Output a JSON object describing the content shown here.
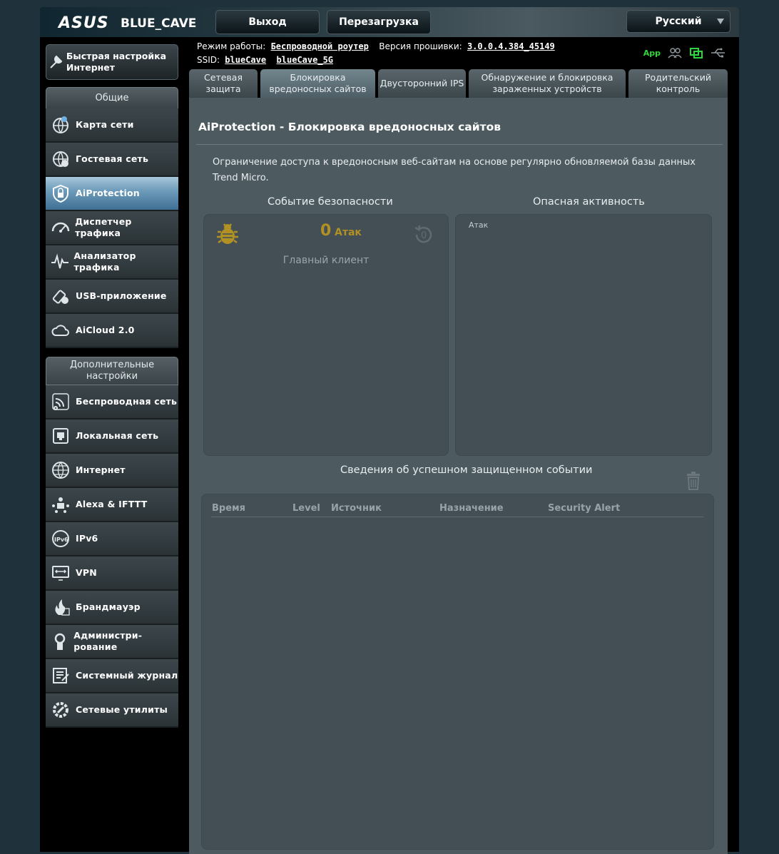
{
  "header": {
    "logo": "ASUS",
    "model": "BLUE_CAVE",
    "logout": "Выход",
    "reboot": "Перезагрузка",
    "language": "Русский"
  },
  "info": {
    "mode_label": "Режим работы:",
    "mode_value": "Беспроводной роутер",
    "fw_label": "Версия прошивки:",
    "fw_value": "3.0.0.4.384_45149",
    "ssid_label": "SSID:",
    "ssid1": "blueCave",
    "ssid2": "blueCave_5G",
    "app": "App"
  },
  "sidebar": {
    "quick_setup": "Быстрая настройка Интернет",
    "general_title": "Общие",
    "general_items": [
      {
        "label": "Карта сети",
        "icon": "network-map-icon"
      },
      {
        "label": "Гостевая сеть",
        "icon": "guest-network-icon"
      },
      {
        "label": "AiProtection",
        "icon": "lock-icon"
      },
      {
        "label": "Диспетчер трафика",
        "icon": "speedometer-icon"
      },
      {
        "label": "Анализатор трафика",
        "icon": "pulse-icon"
      },
      {
        "label": "USB-приложение",
        "icon": "usb-icon"
      },
      {
        "label": "AiCloud 2.0",
        "icon": "cloud-icon"
      }
    ],
    "advanced_title": "Дополнительные настройки",
    "advanced_items": [
      {
        "label": "Беспроводная сеть",
        "icon": "wifi-icon"
      },
      {
        "label": "Локальная сеть",
        "icon": "lan-icon"
      },
      {
        "label": "Интернет",
        "icon": "globe-icon"
      },
      {
        "label": "Alexa & IFTTT",
        "icon": "alexa-icon"
      },
      {
        "label": "IPv6",
        "icon": "ipv6-icon"
      },
      {
        "label": "VPN",
        "icon": "vpn-icon"
      },
      {
        "label": "Брандмауэр",
        "icon": "firewall-icon"
      },
      {
        "label": "Администри-рование",
        "icon": "admin-icon"
      },
      {
        "label": "Системный журнал",
        "icon": "log-icon"
      },
      {
        "label": "Сетевые утилиты",
        "icon": "tools-icon"
      }
    ]
  },
  "tabs": [
    "Сетевая защита",
    "Блокировка вредоносных сайтов",
    "Двусторонний IPS",
    "Обнаружение и блокировка зараженных устройств",
    "Родительский контроль"
  ],
  "main": {
    "title": "AiProtection - Блокировка вредоносных сайтов",
    "description": "Ограничение доступа к вредоносным веб-сайтам на основе регулярно обновляемой базы данных Trend Micro.",
    "security_event_title": "Событие безопасности",
    "threat_activity_title": "Опасная активность",
    "attack_count": "0",
    "attack_label": "Атак",
    "refresh_count": "0",
    "main_client": "Главный клиент",
    "chart_label": "Атак",
    "events_title": "Сведения об успешном защищенном событии",
    "table_headers": [
      "Время",
      "Level",
      "Источник",
      "Назначение",
      "Security Alert"
    ]
  },
  "colors": {
    "accent_gold": "#b29124",
    "active_blue": "#3f6f94",
    "app_green": "#2fd63a"
  }
}
